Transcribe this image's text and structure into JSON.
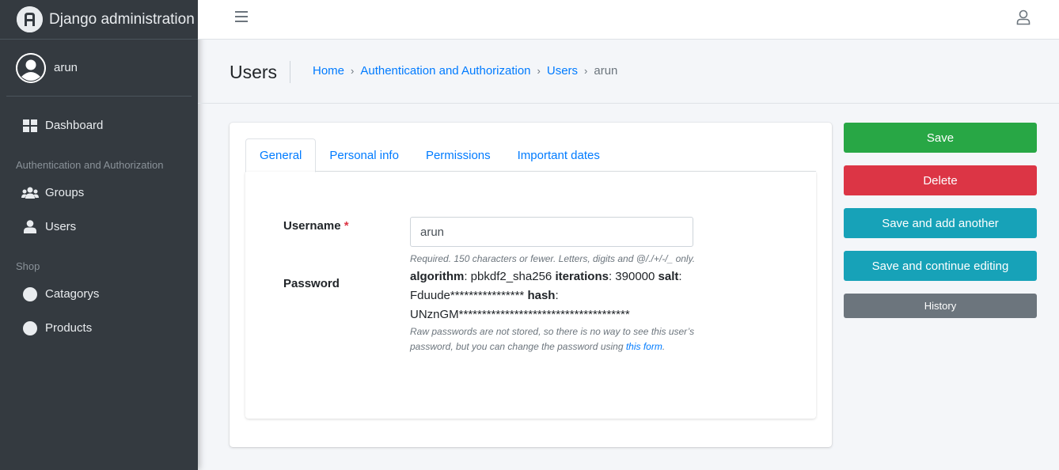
{
  "brand": {
    "title": "Django administration",
    "logo": "django-logo"
  },
  "user_panel": {
    "name": "arun"
  },
  "sidebar": {
    "dashboard": "Dashboard",
    "sections": [
      {
        "header": "Authentication and Authorization",
        "items": [
          "Groups",
          "Users"
        ]
      },
      {
        "header": "Shop",
        "items": [
          "Catagorys",
          "Products"
        ]
      }
    ]
  },
  "header": {
    "title": "Users",
    "breadcrumb": [
      "Home",
      "Authentication and Authorization",
      "Users",
      "arun"
    ]
  },
  "tabs": [
    "General",
    "Personal info",
    "Permissions",
    "Important dates"
  ],
  "form": {
    "username_label": "Username",
    "required_mark": "*",
    "username_value": "arun",
    "username_help": "Required. 150 characters or fewer. Letters, digits and @/./+/-/_ only.",
    "password_label": "Password",
    "algorithm_label": "algorithm",
    "algorithm_value": ": pbkdf2_sha256 ",
    "iterations_label": "iterations",
    "iterations_value": ": 390000 ",
    "salt_label": "salt",
    "salt_value": ": Fduude**************** ",
    "hash_label": "hash",
    "hash_value": ": UNznGM*************************************",
    "password_help": "Raw passwords are not stored, so there is no way to see this user’s password, but you can change the password using ",
    "password_link": "this form",
    "password_help_end": "."
  },
  "actions": {
    "save": "Save",
    "delete": "Delete",
    "save_add": "Save and add another",
    "save_continue": "Save and continue editing",
    "history": "History"
  },
  "colors": {
    "success": "#28a745",
    "danger": "#dc3545",
    "info": "#17a2b8",
    "secondary": "#6c757d",
    "link": "#007bff",
    "sidebar": "#343a40"
  }
}
